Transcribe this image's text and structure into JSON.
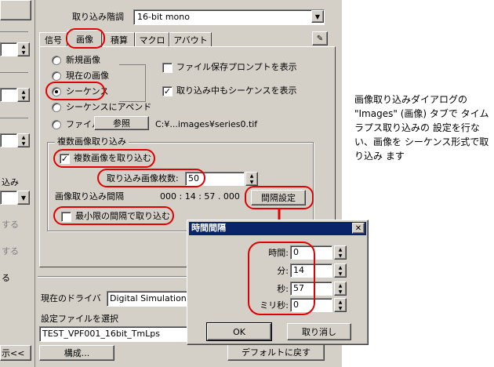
{
  "dialog": {
    "acquisition_depth_label": "取り込み階調",
    "acquisition_depth_value": "16-bit mono",
    "tabs": [
      "信号",
      "画像",
      "積算",
      "マクロ",
      "アバウト"
    ],
    "radio_options": [
      "新規画像",
      "現在の画像",
      "シーケンス",
      "シーケンスにアペンド",
      "ファイル"
    ],
    "browse_button": "参照",
    "file_path": "C:¥...images¥series0.tif",
    "checkbox_prompt_save": "ファイル保存プロンプトを表示",
    "checkbox_show_sequence": "取り込み中もシーケンスを表示",
    "multi_group_title": "複数画像取り込み",
    "multi_capture_label": "複数画像を取り込む",
    "capture_count_label": "取り込み画像枚数:",
    "capture_count_value": "50",
    "interval_label": "画像取り込み間隔",
    "interval_value": "000 : 14 : 57 . 000",
    "interval_button": "間隔設定",
    "min_interval_label": "最小限の間隔で取り込む",
    "driver_label": "現在のドライバ",
    "driver_value": "Digital Simulation C",
    "settings_file_label": "設定ファイルを選択",
    "settings_file_value": "TEST_VPF001_16bit_TmLps",
    "configure_button": "構成...",
    "defaults_button": "デフォルトに戻す",
    "left_fragments": [
      "込み",
      "する",
      "する",
      "る",
      "示<<"
    ]
  },
  "interval_dialog": {
    "title": "時間間隔",
    "fields": [
      {
        "label": "時間:",
        "value": "0"
      },
      {
        "label": "分:",
        "value": "14"
      },
      {
        "label": "秒:",
        "value": "57"
      },
      {
        "label": "ミリ秒:",
        "value": "0"
      }
    ],
    "ok_button": "OK",
    "cancel_button": "取り消し"
  },
  "annotation": "画像取り込みダイアログの \"Images\" (画像) タブで タイムラプス取り込みの 設定を行ない、画像を シーケンス形式で取り込み ます",
  "colors": {
    "highlight_ring": "#e00000",
    "dialog_face": "#d4d0c8",
    "title_bar": "#0a246a"
  }
}
